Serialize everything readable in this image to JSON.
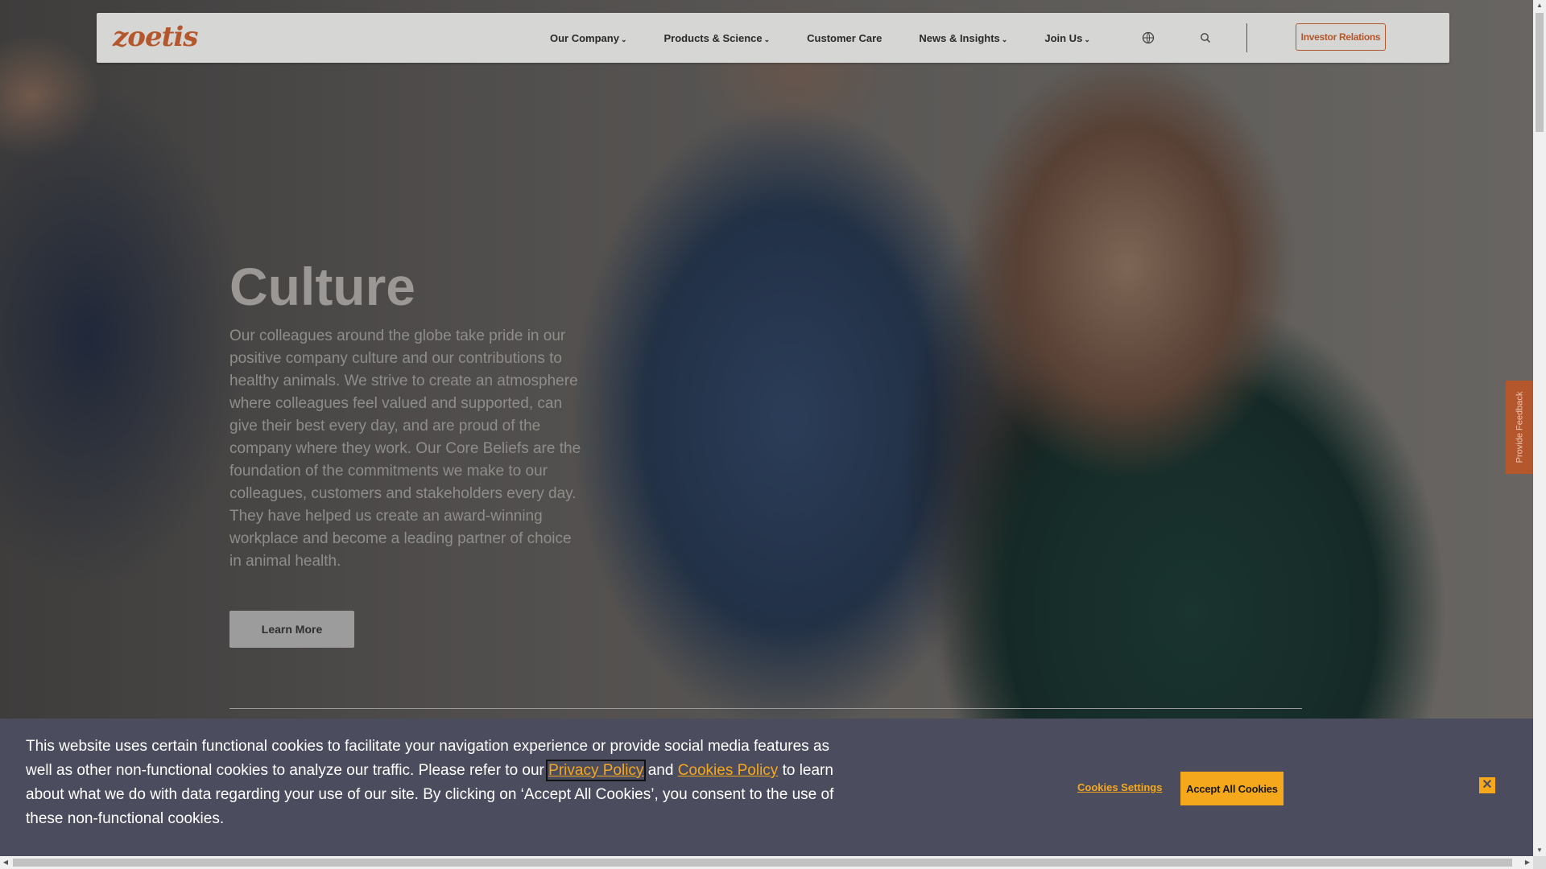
{
  "brand": {
    "logo_text": "zoetis",
    "accent_color": "#b5572c"
  },
  "nav": {
    "items": [
      {
        "label": "Our Company",
        "has_dropdown": true
      },
      {
        "label": "Products & Science",
        "has_dropdown": true
      },
      {
        "label": "Customer Care",
        "has_dropdown": false
      },
      {
        "label": "News & Insights",
        "has_dropdown": true
      },
      {
        "label": "Join Us",
        "has_dropdown": true
      }
    ],
    "chevron": "⌄",
    "globe_icon": "globe-icon",
    "search_icon": "search-icon",
    "investor_label": "Investor Relations"
  },
  "hero": {
    "title": "Culture",
    "text": "Our colleagues around the globe take pride in our positive company culture and our contributions to healthy animals. We strive to create an atmosphere where colleagues feel valued and supported, can give their best every day, and are proud of the company where they work. Our Core Beliefs are the foundation of the commitments we make to our colleagues, customers and stakeholders every day. They have helped us create an award-winning workplace and become a leading partner of choice in animal health.",
    "button_label": "Learn More"
  },
  "feedback": {
    "label": "Provide Feedback"
  },
  "cookie_banner": {
    "text_part1": "This website uses certain functional cookies to facilitate your navigation experience or provide social media features as well as other non-functional cookies to analyze our traffic. Please refer to our ",
    "privacy_link": "Privacy Policy",
    "text_part2": " and ",
    "cookies_link": "Cookies Policy",
    "text_part3": " to learn about what we do with data regarding your use of our site. By clicking on ‘Accept All Cookies’, you consent to the use of these non-functional cookies.",
    "settings_label": "Cookies Settings",
    "accept_label": "Accept All Cookies",
    "close_symbol": "✕",
    "accent_color": "#f6a81c"
  }
}
